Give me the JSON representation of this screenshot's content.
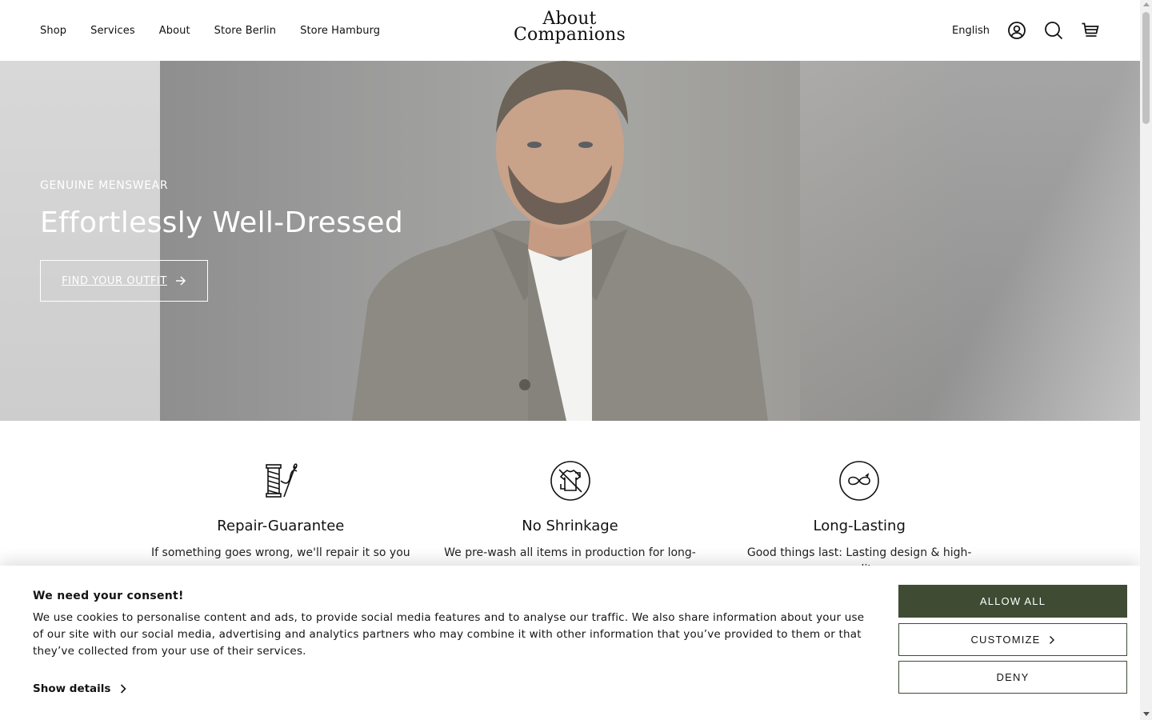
{
  "header": {
    "nav": [
      "Shop",
      "Services",
      "About",
      "Store Berlin",
      "Store Hamburg"
    ],
    "logo_line1": "About",
    "logo_line2": "Companions",
    "language": "English",
    "icons": [
      "account-icon",
      "search-icon",
      "cart-icon"
    ]
  },
  "hero": {
    "kicker": "GENUINE MENSWEAR",
    "title": "Effortlessly Well-Dressed",
    "button_label": "FIND YOUR OUTFIT",
    "button_icon": "arrow-right-icon"
  },
  "features": [
    {
      "icon": "thread-needle-icon",
      "title": "Repair-Guarantee",
      "text": "If something goes wrong, we'll repair it so you"
    },
    {
      "icon": "no-shrink-shirt-icon",
      "title": "No Shrinkage",
      "text": "We pre-wash all items in production for long-"
    },
    {
      "icon": "infinity-icon",
      "title": "Long-Lasting",
      "text": "Good things last: Lasting design & high-quality"
    }
  ],
  "consent": {
    "title": "We need your consent!",
    "text": "We use cookies to personalise content and ads, to provide social media features and to analyse our traffic. We also share information about your use of our site with our social media, advertising and analytics partners who may combine it with other information that you’ve provided to them or that they’ve collected from your use of their services.",
    "show_details": "Show details",
    "allow_all": "ALLOW ALL",
    "customize": "CUSTOMIZE",
    "deny": "DENY",
    "accent_color": "#3f4c33"
  }
}
